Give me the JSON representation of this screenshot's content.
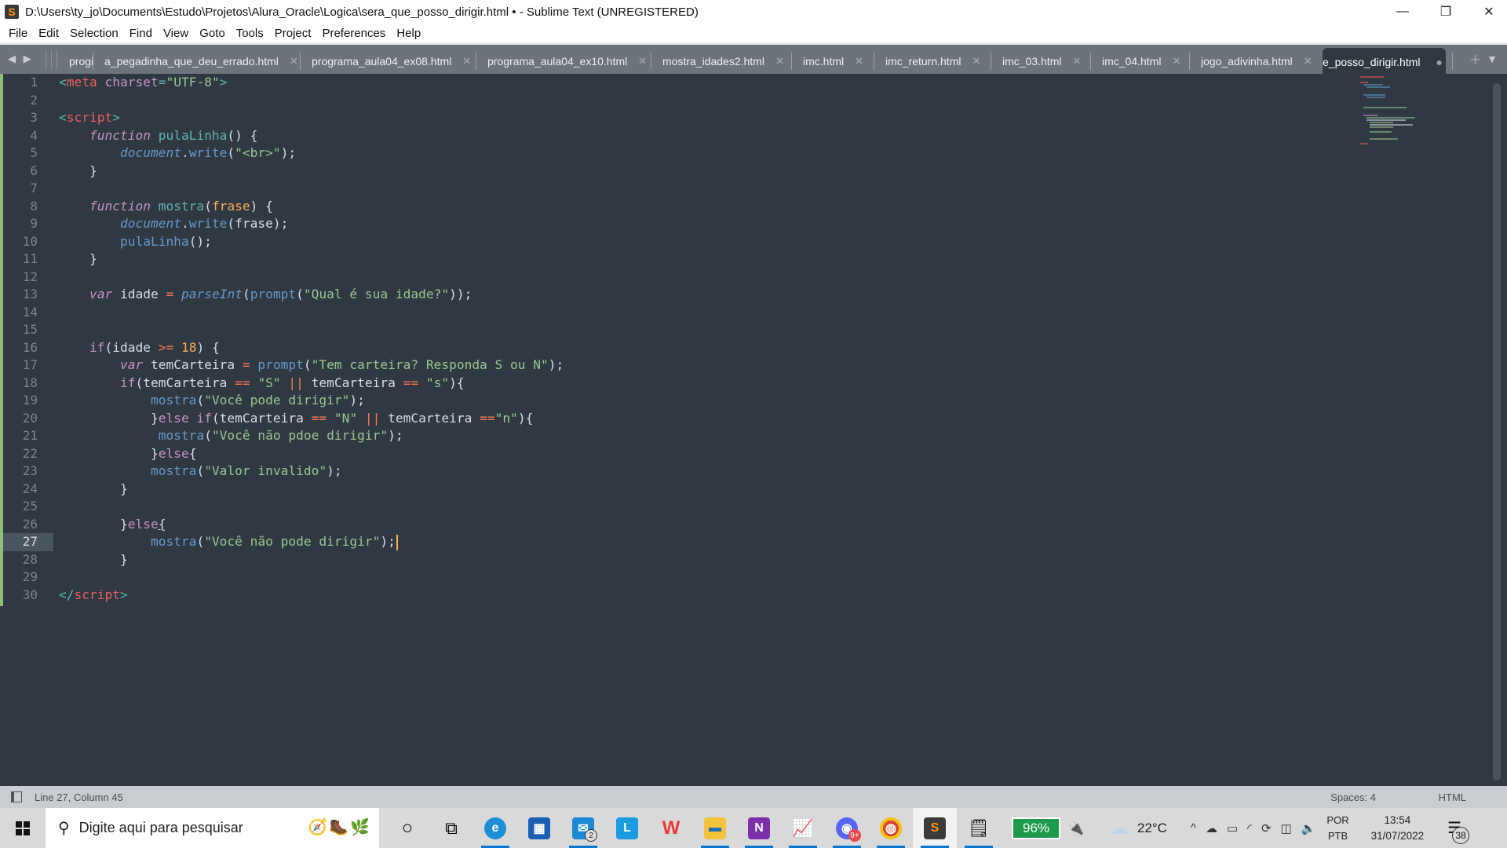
{
  "window": {
    "title": "D:\\Users\\ty_jo\\Documents\\Estudo\\Projetos\\Alura_Oracle\\Logica\\sera_que_posso_dirigir.html • - Sublime Text (UNREGISTERED)",
    "app_logo_glyph": "S",
    "controls": {
      "minimize": "—",
      "maximize": "❐",
      "close": "✕"
    }
  },
  "menu": [
    "File",
    "Edit",
    "Selection",
    "Find",
    "View",
    "Goto",
    "Tools",
    "Project",
    "Preferences",
    "Help"
  ],
  "tabs": {
    "nav_arrows": "◀ ▶",
    "truncated_first": "progi",
    "items": [
      {
        "label": "a_pegadinha_que_deu_errado.html",
        "close": "✕"
      },
      {
        "label": "programa_aula04_ex08.html",
        "close": "✕"
      },
      {
        "label": "programa_aula04_ex10.html",
        "close": "✕"
      },
      {
        "label": "mostra_idades2.html",
        "close": "✕"
      },
      {
        "label": "imc.html",
        "close": "✕"
      },
      {
        "label": "imc_return.html",
        "close": "✕"
      },
      {
        "label": "imc_03.html",
        "close": "✕"
      },
      {
        "label": "imc_04.html",
        "close": "✕"
      },
      {
        "label": "jogo_adivinha.html",
        "close": "✕"
      }
    ],
    "active": {
      "label": "e_posso_dirigir.html",
      "modified_dot": "●"
    },
    "new_tab": "+",
    "dropdown": "▼"
  },
  "editor": {
    "current_line": 27,
    "line_numbers": [
      "1",
      "2",
      "3",
      "4",
      "5",
      "6",
      "7",
      "8",
      "9",
      "10",
      "11",
      "12",
      "13",
      "14",
      "15",
      "16",
      "17",
      "18",
      "19",
      "20",
      "21",
      "22",
      "23",
      "24",
      "25",
      "26",
      "27",
      "28",
      "29",
      "30"
    ],
    "code": {
      "l1": {
        "lt": "<",
        "tag": "meta",
        "sp": " ",
        "attr": "charset",
        "eq": "=",
        "val": "\"UTF-8\"",
        "gt": ">"
      },
      "l3": {
        "lt": "<",
        "tag": "script",
        "gt": ">"
      },
      "l4": {
        "indent": "    ",
        "kw": "function",
        "sp": " ",
        "name": "pulaLinha",
        "rest": "() {"
      },
      "l5": {
        "indent": "        ",
        "obj": "document",
        "dot": ".",
        "method": "write",
        "p1": "(",
        "str": "\"<br>\"",
        "p2": ");"
      },
      "l6": {
        "text": "    }"
      },
      "l8": {
        "indent": "    ",
        "kw": "function",
        "sp": " ",
        "name": "mostra",
        "p1": "(",
        "param": "frase",
        "rest": ") {"
      },
      "l9": {
        "indent": "        ",
        "obj": "document",
        "dot": ".",
        "method": "write",
        "rest": "(frase);"
      },
      "l10": {
        "indent": "        ",
        "call": "pulaLinha",
        "rest": "();"
      },
      "l11": {
        "text": "    }"
      },
      "l13": {
        "indent": "    ",
        "kw": "var",
        "id": " idade ",
        "eq": "=",
        "sp": " ",
        "fn": "parseInt",
        "p1": "(",
        "call": "prompt",
        "p2": "(",
        "str": "\"Qual é sua idade?\"",
        "end": "));"
      },
      "l16": {
        "indent": "    ",
        "kw": "if",
        "a": "(idade ",
        "op": ">=",
        "sp": " ",
        "num": "18",
        "end": ") {"
      },
      "l17": {
        "indent": "        ",
        "kw": "var",
        "id": " temCarteira ",
        "eq": "=",
        "sp": " ",
        "call": "prompt",
        "p1": "(",
        "str": "\"Tem carteira? Responda S ou N\"",
        "end": ");"
      },
      "l18": {
        "indent": "        ",
        "kw": "if",
        "a": "(temCarteira ",
        "eq1": "==",
        "sp1": " ",
        "s1": "\"S\"",
        "sp2": " ",
        "or": "||",
        "b": " temCarteira ",
        "eq2": "==",
        "sp3": " ",
        "s2": "\"s\"",
        "end": "){"
      },
      "l19": {
        "indent": "            ",
        "call": "mostra",
        "p1": "(",
        "str": "\"Você pode dirigir\"",
        "end": ");"
      },
      "l20": {
        "indent": "            ",
        "br": "}",
        "kw": "else if",
        "a": "(temCarteira ",
        "eq1": "==",
        "sp1": " ",
        "s1": "\"N\"",
        "sp2": " ",
        "or": "||",
        "b": " temCarteira ",
        "eq2": "==",
        "s2": "\"n\"",
        "end": "){"
      },
      "l21": {
        "indent": "             ",
        "call": "mostra",
        "p1": "(",
        "str": "\"Você não pdoe dirigir\"",
        "end": ");"
      },
      "l22": {
        "indent": "            ",
        "br": "}",
        "kw": "else",
        "end": "{"
      },
      "l23": {
        "indent": "            ",
        "call": "mostra",
        "p1": "(",
        "str": "\"Valor invalido\"",
        "end": ");"
      },
      "l24": {
        "text": "        }"
      },
      "l26": {
        "indent": "        ",
        "br": "}",
        "kw": "else",
        "end": "{"
      },
      "l27": {
        "indent": "            ",
        "call": "mostra",
        "p1": "(",
        "str": "\"Você não pode dirigir\"",
        "end": ");"
      },
      "l28": {
        "text": "        }"
      },
      "l30": {
        "lt": "</",
        "tag": "script",
        "gt": ">"
      }
    }
  },
  "status": {
    "position": "Line 27, Column 45",
    "spaces": "Spaces: 4",
    "syntax": "HTML"
  },
  "taskbar": {
    "search_placeholder": "Digite aqui para pesquisar",
    "search_art": "🧭🥾🌿",
    "apps": [
      {
        "name": "cortana",
        "glyph": "○"
      },
      {
        "name": "task-view",
        "glyph": "⧉"
      },
      {
        "name": "edge",
        "glyph": "e",
        "color": "#1c8fd6"
      },
      {
        "name": "store",
        "glyph": "▦",
        "color": "#1a5fb4"
      },
      {
        "name": "mail",
        "glyph": "✉",
        "color": "#1a8ad4",
        "badge": "2"
      },
      {
        "name": "l-app",
        "glyph": "L",
        "color": "#1b9be0"
      },
      {
        "name": "wps",
        "glyph": "W",
        "color": "#e53935"
      },
      {
        "name": "file-explorer",
        "glyph": "▬",
        "color": "#f3c33b"
      },
      {
        "name": "onenote",
        "glyph": "N",
        "color": "#7b2fa8"
      },
      {
        "name": "performance-monitor",
        "glyph": "📈"
      },
      {
        "name": "discord",
        "glyph": "◉",
        "color": "#5865f2",
        "badge": "9+"
      },
      {
        "name": "chrome",
        "glyph": "◍",
        "color": "#db4437"
      },
      {
        "name": "sublime-text",
        "glyph": "S",
        "color": "#3b3b3b"
      },
      {
        "name": "notepad",
        "glyph": "🗒"
      }
    ],
    "battery_percent": "96%",
    "weather_temp": "22°C",
    "tray_chevron": "^",
    "lang_top": "POR",
    "lang_bottom": "PTB",
    "time": "13:54",
    "date": "31/07/2022",
    "notification_count": "38"
  }
}
